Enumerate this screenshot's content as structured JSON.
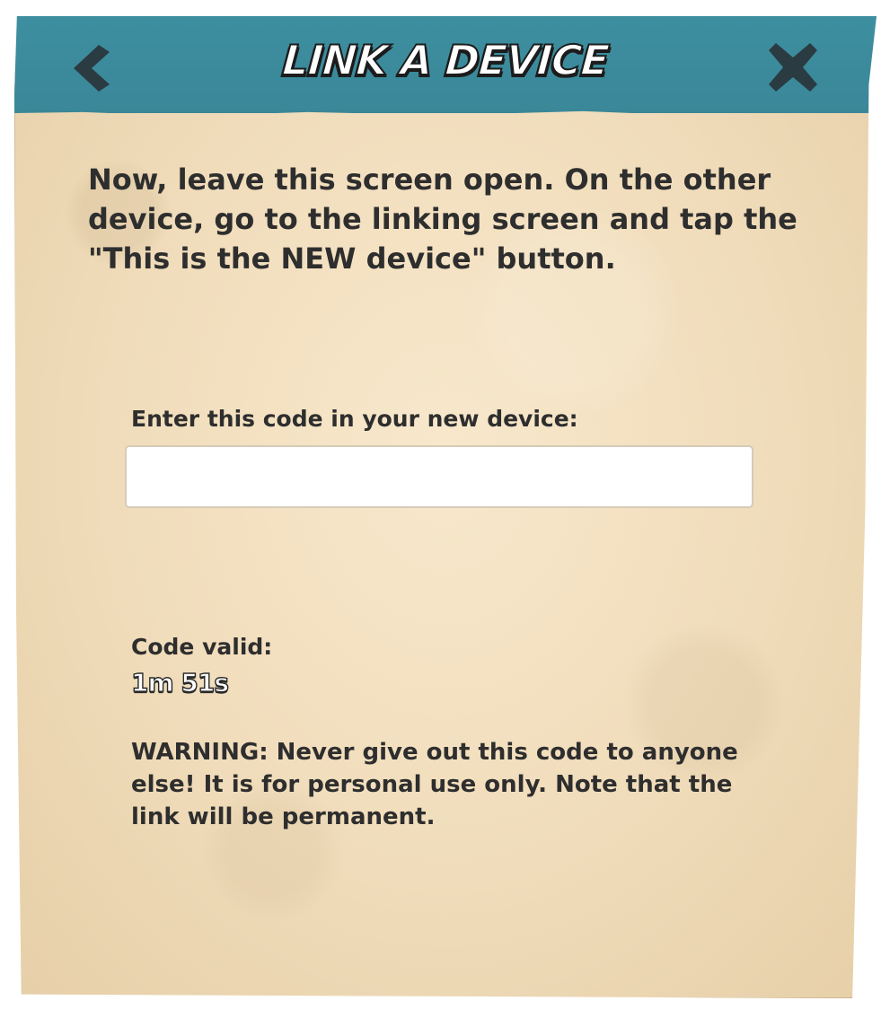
{
  "dialog": {
    "title": "LINK A DEVICE",
    "back_icon": "chevron-left-icon",
    "close_icon": "close-x-icon",
    "header_color": "#3a8a9b",
    "instructions": "Now, leave this screen open. On the other device, go to the linking screen and tap the \"This is the NEW device\" button.",
    "code_label": "Enter this code in your new device:",
    "code_value": "",
    "valid_label": "Code valid:",
    "valid_time": "1m 51s",
    "warning": "WARNING: Never give out this code to anyone else! It is for personal use only. Note that the link will be permanent."
  }
}
